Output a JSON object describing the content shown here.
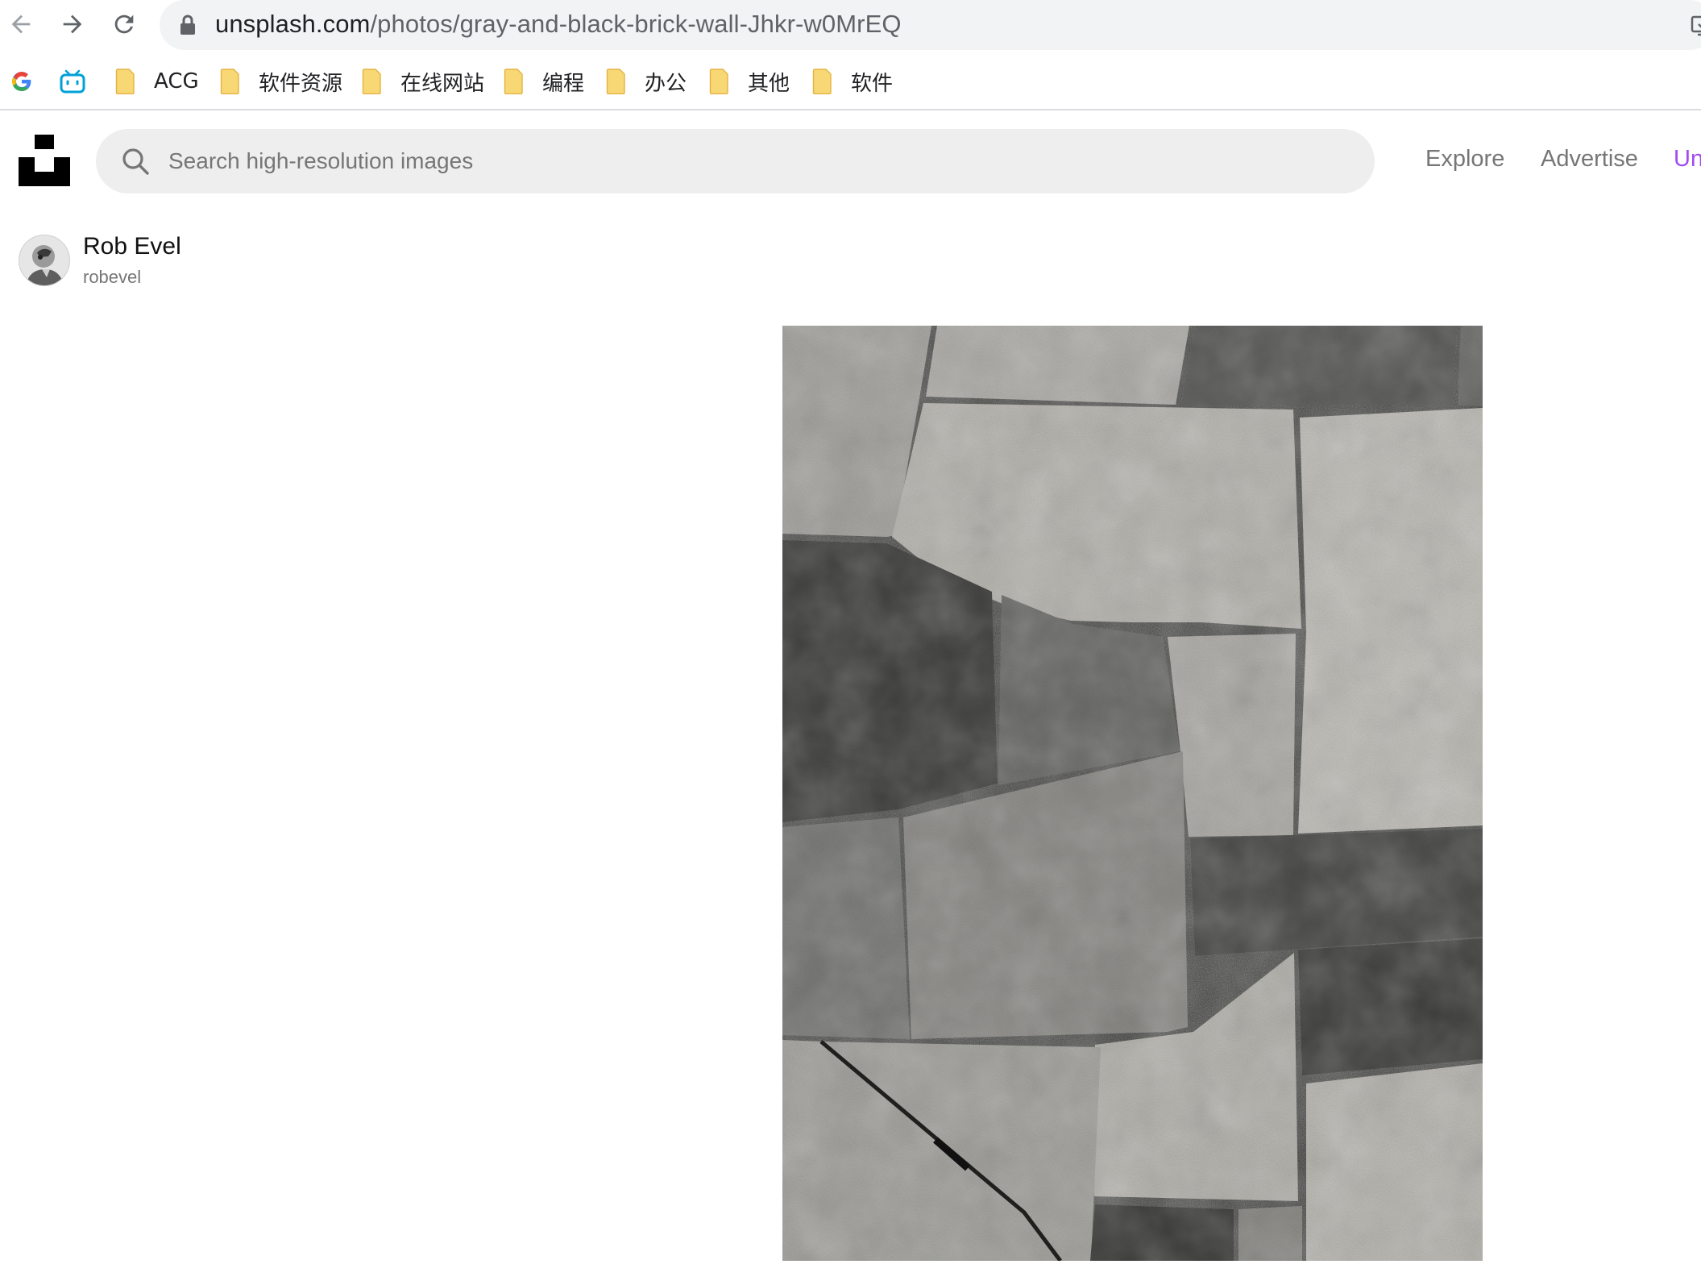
{
  "browser": {
    "url_host": "unsplash.com",
    "url_path": "/photos/gray-and-black-brick-wall-Jhkr-w0MrEQ",
    "nav": {
      "back_icon": "arrow-left-icon",
      "forward_icon": "arrow-right-icon",
      "reload_icon": "reload-icon"
    }
  },
  "bookmarks": [
    {
      "icon": "google-icon",
      "label": ""
    },
    {
      "icon": "bilibili-icon",
      "label": ""
    },
    {
      "icon": "folder-icon",
      "label": "ACG"
    },
    {
      "icon": "folder-icon",
      "label": "软件资源"
    },
    {
      "icon": "folder-icon",
      "label": "在线网站"
    },
    {
      "icon": "folder-icon",
      "label": "编程"
    },
    {
      "icon": "folder-icon",
      "label": "办公"
    },
    {
      "icon": "folder-icon",
      "label": "其他"
    },
    {
      "icon": "folder-icon",
      "label": "软件"
    }
  ],
  "header": {
    "search": {
      "placeholder": "Search high-resolution images",
      "value": ""
    },
    "links": {
      "explore": "Explore",
      "advertise": "Advertise",
      "unsplash_plus": "Un"
    },
    "accent_color": "#a349f0"
  },
  "author": {
    "name": "Rob Evel",
    "handle": "robevel"
  },
  "photo": {
    "subject": "stone-wall-photo"
  }
}
